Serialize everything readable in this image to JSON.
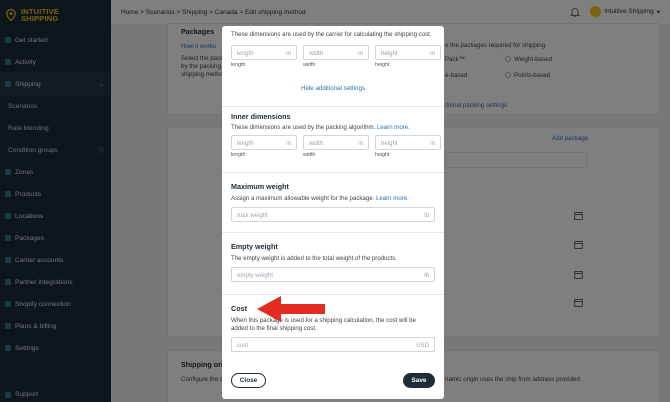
{
  "brand": {
    "line1": "INTUITIVE",
    "line2": "SHIPPING"
  },
  "sidebar": {
    "items": [
      {
        "label": "Get started",
        "icon": "rocket-icon"
      },
      {
        "label": "Activity",
        "icon": "activity-icon"
      },
      {
        "label": "Shipping",
        "icon": "truck-icon",
        "chevron": "⌄"
      },
      {
        "label": "Scenarios",
        "sub": true
      },
      {
        "label": "Rate blending",
        "sub": true
      },
      {
        "label": "Condition groups",
        "sub": true,
        "badge": "ⓘ"
      },
      {
        "label": "Zones",
        "icon": "zones-icon"
      },
      {
        "label": "Products",
        "icon": "products-icon"
      },
      {
        "label": "Locations",
        "icon": "locations-icon"
      },
      {
        "label": "Packages",
        "icon": "packages-icon"
      },
      {
        "label": "Carrier accounts",
        "icon": "carrier-icon"
      },
      {
        "label": "Partner integrations",
        "icon": "partner-icon"
      },
      {
        "label": "Shopify connection",
        "icon": "shopify-icon"
      },
      {
        "label": "Plans & billing",
        "icon": "billing-icon"
      },
      {
        "label": "Settings",
        "icon": "gear-icon"
      }
    ],
    "support": "Support"
  },
  "topbar": {
    "breadcrumb": "Home > Scenarios > Shipping > Canada > Edit shipping method",
    "account": "Intuitive Shipping",
    "account_chevron": "▾"
  },
  "background": {
    "packages_title": "Packages",
    "how_it_works": "How it works",
    "select_pack": "Select the pack",
    "by_packing": "by the packing",
    "shipping_meth": "shipping metho",
    "packages_required": "e the packages required for shipping.",
    "pack_option": "Pack™",
    "weight_based": "Weight-based",
    "e_based": "e-based",
    "points_based": "Points-based",
    "additional_packing": "itional packing settings",
    "add_package": "Add package",
    "shipping_origin": "Shipping origi",
    "configure": "Configure the c",
    "origin_text": "namic origin uses the ship from address provided"
  },
  "modal": {
    "outer_desc": "These dimensions are used by the carrier for calculating the shipping cost.",
    "outer_fields": [
      {
        "placeholder": "length",
        "unit": "in",
        "caption": "length"
      },
      {
        "placeholder": "width",
        "unit": "in",
        "caption": "width"
      },
      {
        "placeholder": "height",
        "unit": "in",
        "caption": "height"
      }
    ],
    "hide_link": "Hide additional settings",
    "inner_title": "Inner dimensions",
    "inner_desc": "These dimensions are used by the packing algorithm.",
    "learn_more": "Learn more.",
    "inner_fields": [
      {
        "placeholder": "length",
        "unit": "in",
        "caption": "length"
      },
      {
        "placeholder": "width",
        "unit": "in",
        "caption": "width"
      },
      {
        "placeholder": "height",
        "unit": "in",
        "caption": "height"
      }
    ],
    "max_title": "Maximum weight",
    "max_desc": "Assign a maximum allowable weight for the package.",
    "max_placeholder": "max weight",
    "max_unit": "lb",
    "empty_title": "Empty weight",
    "empty_desc": "The empty weight is added to the total weight of the products.",
    "empty_placeholder": "empty weight",
    "empty_unit": "lb",
    "cost_title": "Cost",
    "cost_desc": "When this package is used for a shipping calculation, the cost will be added to the final shipping cost.",
    "cost_placeholder": "cost",
    "cost_unit": "USD",
    "close_label": "Close",
    "save_label": "Save"
  },
  "colors": {
    "sidebar": "#1f2c37",
    "brand_yellow": "#f2c31f",
    "link": "#2a70b9",
    "arrow": "#e32b22"
  }
}
